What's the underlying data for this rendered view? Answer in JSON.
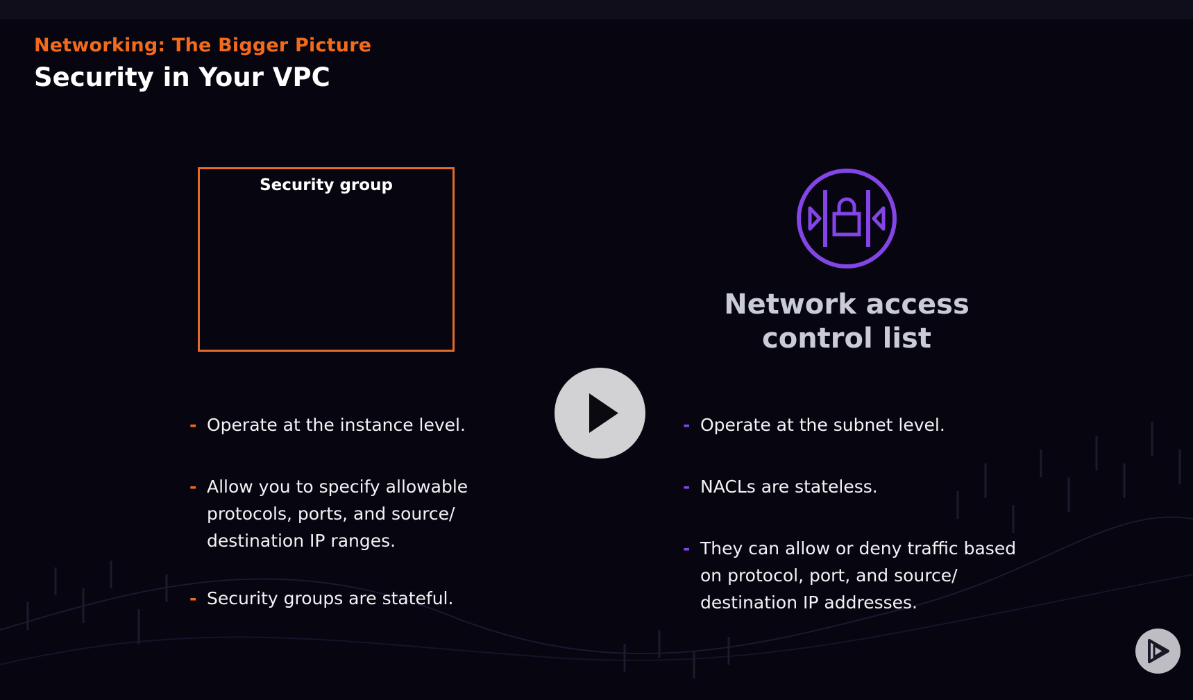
{
  "header": {
    "eyebrow": "Networking: The Bigger Picture",
    "title": "Security in Your VPC"
  },
  "security_group": {
    "box_label": "Security group",
    "accent_color": "#f26b1d",
    "bullets": [
      {
        "text": "Operate at the instance level."
      },
      {
        "text": "Allow you to specify allowable protocols, ports, and source/ destination IP ranges."
      },
      {
        "text": "Security groups are stateful."
      }
    ]
  },
  "nacl": {
    "icon": "lock-shield-icon",
    "title": "Network access control list",
    "accent_color": "#8445e8",
    "bullets": [
      {
        "text": "Operate at the subnet level."
      },
      {
        "text": "NACLs are stateless."
      },
      {
        "text": "They can allow or deny traffic based on protocol, port, and source/ destination IP addresses."
      }
    ]
  },
  "player": {
    "play_icon": "play-icon",
    "logo_icon": "pluralsight-logo-icon"
  }
}
